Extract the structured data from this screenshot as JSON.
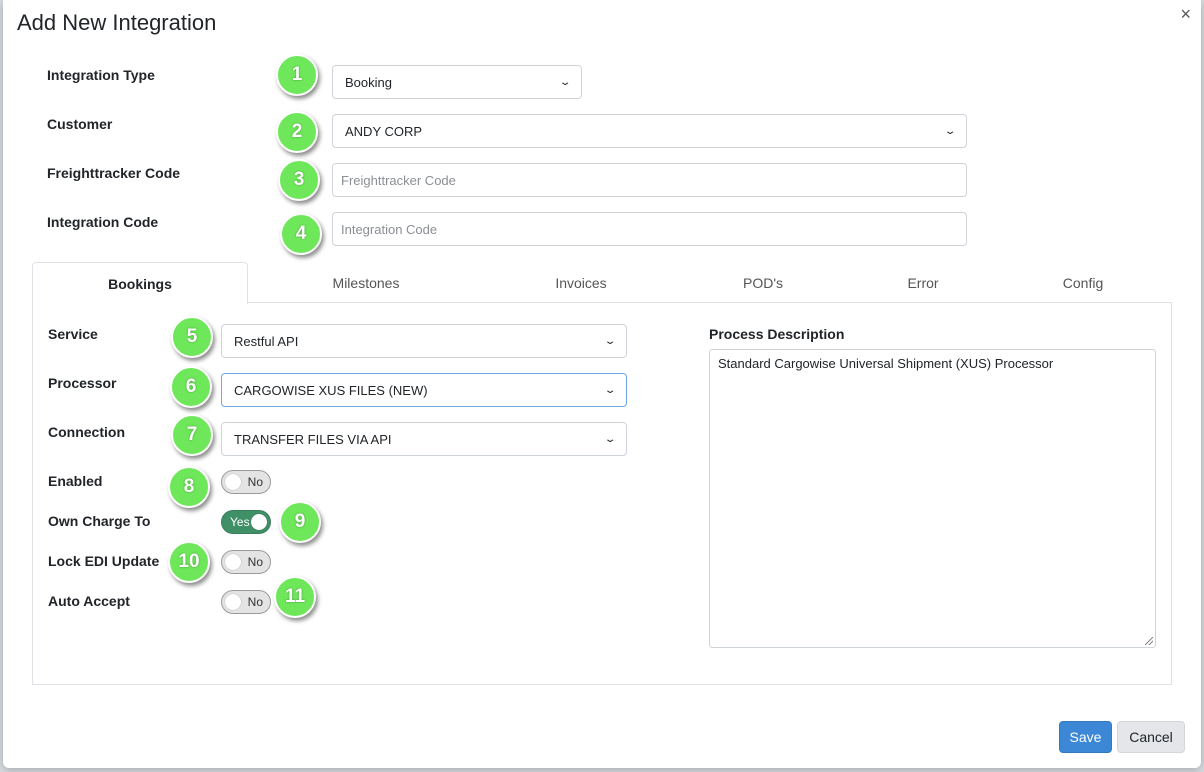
{
  "modal": {
    "title": "Add New Integration",
    "close_glyph": "×",
    "save_label": "Save",
    "cancel_label": "Cancel"
  },
  "top_form": {
    "integration_type": {
      "label": "Integration Type",
      "value": "Booking"
    },
    "customer": {
      "label": "Customer",
      "value": "ANDY CORP"
    },
    "freighttracker_code": {
      "label": "Freighttracker Code",
      "placeholder": "Freighttracker Code",
      "value": ""
    },
    "integration_code": {
      "label": "Integration Code",
      "placeholder": "Integration Code",
      "value": ""
    }
  },
  "tabs": [
    {
      "label": "Bookings",
      "active": true
    },
    {
      "label": "Milestones",
      "active": false
    },
    {
      "label": "Invoices",
      "active": false
    },
    {
      "label": "POD's",
      "active": false
    },
    {
      "label": "Error",
      "active": false
    },
    {
      "label": "Config",
      "active": false
    }
  ],
  "bookings": {
    "service": {
      "label": "Service",
      "value": "Restful API"
    },
    "processor": {
      "label": "Processor",
      "value": "CARGOWISE XUS FILES (NEW)"
    },
    "connection": {
      "label": "Connection",
      "value": "TRANSFER FILES VIA API"
    },
    "enabled": {
      "label": "Enabled",
      "state": "No"
    },
    "own_charge_to": {
      "label": "Own Charge To",
      "state": "Yes"
    },
    "lock_edi_update": {
      "label": "Lock EDI Update",
      "state": "No"
    },
    "auto_accept": {
      "label": "Auto Accept",
      "state": "No"
    },
    "process_description": {
      "label": "Process Description",
      "value": "Standard Cargowise Universal Shipment (XUS) Processor"
    }
  },
  "callouts": [
    "1",
    "2",
    "3",
    "4",
    "5",
    "6",
    "7",
    "8",
    "9",
    "10",
    "11"
  ],
  "colors": {
    "callout": "#6ee85a",
    "toggle_on": "#3f8f67",
    "primary": "#3d88d6"
  },
  "icons": {
    "select_arrow": "chevron-down-icon",
    "close": "close-icon"
  }
}
